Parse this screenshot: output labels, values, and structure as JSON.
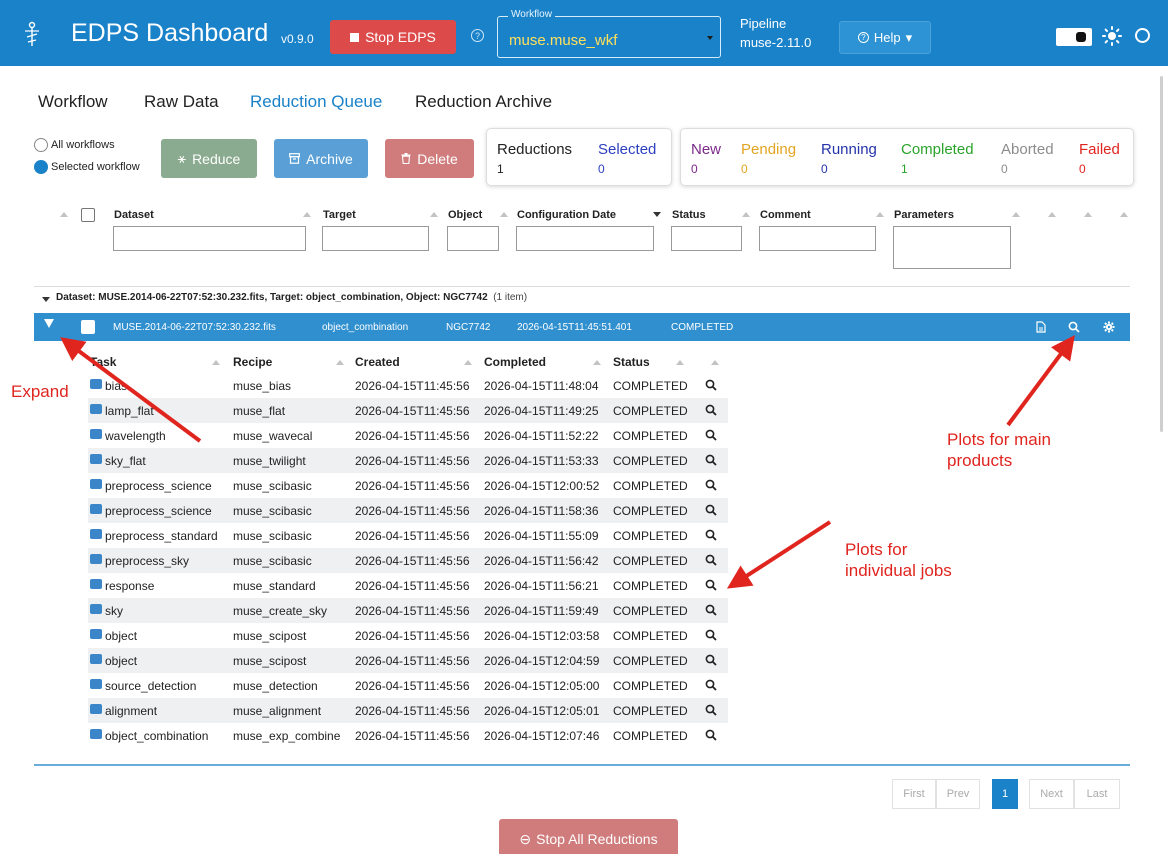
{
  "header": {
    "title": "EDPS Dashboard",
    "version": "v0.9.0",
    "stop_label": "Stop EDPS",
    "workflow_legend": "Workflow",
    "workflow_value": "muse.muse_wkf",
    "pipeline_label": "Pipeline",
    "pipeline_value": "muse-2.11.0",
    "help_label": "Help",
    "help_caret": "▾",
    "colors": {
      "bar": "#1a82c9",
      "workflow_value": "#ffe05a",
      "stop": "#dc4a4a"
    }
  },
  "tabs": [
    "Workflow",
    "Raw Data",
    "Reduction Queue",
    "Reduction Archive"
  ],
  "controls": {
    "radio_all": "All workflows",
    "radio_selected": "Selected workflow",
    "reduce": "Reduce",
    "archive": "Archive",
    "delete": "Delete"
  },
  "stats_left": [
    {
      "label": "Reductions",
      "value": "1",
      "color": "#222222"
    },
    {
      "label": "Selected",
      "value": "0",
      "color": "#2d3fbf"
    }
  ],
  "stats_right": [
    {
      "label": "New",
      "value": "0",
      "color": "#7b2a8a"
    },
    {
      "label": "Pending",
      "value": "0",
      "color": "#e3a521"
    },
    {
      "label": "Running",
      "value": "0",
      "color": "#2534a8"
    },
    {
      "label": "Completed",
      "value": "1",
      "color": "#2aa32a"
    },
    {
      "label": "Aborted",
      "value": "0",
      "color": "#8c8c8c"
    },
    {
      "label": "Failed",
      "value": "0",
      "color": "#e0251f"
    }
  ],
  "table_headers": {
    "dataset": "Dataset",
    "target": "Target",
    "object": "Object",
    "config_date": "Configuration Date",
    "status": "Status",
    "comment": "Comment",
    "parameters": "Parameters"
  },
  "group": {
    "label": "Dataset: MUSE.2014-06-22T07:52:30.232.fits, Target: object_combination, Object: NGC7742",
    "count": "(1 item)"
  },
  "selected_row": {
    "dataset": "MUSE.2014-06-22T07:52:30.232.fits",
    "target": "object_combination",
    "object": "NGC7742",
    "date": "2026-04-15T11:45:51.401",
    "status": "COMPLETED"
  },
  "jobs_headers": {
    "task": "Task",
    "recipe": "Recipe",
    "created": "Created",
    "completed": "Completed",
    "status": "Status"
  },
  "jobs": [
    {
      "task": "bias",
      "recipe": "muse_bias",
      "created": "2026-04-15T11:45:56",
      "completed": "2026-04-15T11:48:04",
      "status": "COMPLETED"
    },
    {
      "task": "lamp_flat",
      "recipe": "muse_flat",
      "created": "2026-04-15T11:45:56",
      "completed": "2026-04-15T11:49:25",
      "status": "COMPLETED"
    },
    {
      "task": "wavelength",
      "recipe": "muse_wavecal",
      "created": "2026-04-15T11:45:56",
      "completed": "2026-04-15T11:52:22",
      "status": "COMPLETED"
    },
    {
      "task": "sky_flat",
      "recipe": "muse_twilight",
      "created": "2026-04-15T11:45:56",
      "completed": "2026-04-15T11:53:33",
      "status": "COMPLETED"
    },
    {
      "task": "preprocess_science",
      "recipe": "muse_scibasic",
      "created": "2026-04-15T11:45:56",
      "completed": "2026-04-15T12:00:52",
      "status": "COMPLETED"
    },
    {
      "task": "preprocess_science",
      "recipe": "muse_scibasic",
      "created": "2026-04-15T11:45:56",
      "completed": "2026-04-15T11:58:36",
      "status": "COMPLETED"
    },
    {
      "task": "preprocess_standard",
      "recipe": "muse_scibasic",
      "created": "2026-04-15T11:45:56",
      "completed": "2026-04-15T11:55:09",
      "status": "COMPLETED"
    },
    {
      "task": "preprocess_sky",
      "recipe": "muse_scibasic",
      "created": "2026-04-15T11:45:56",
      "completed": "2026-04-15T11:56:42",
      "status": "COMPLETED"
    },
    {
      "task": "response",
      "recipe": "muse_standard",
      "created": "2026-04-15T11:45:56",
      "completed": "2026-04-15T11:56:21",
      "status": "COMPLETED"
    },
    {
      "task": "sky",
      "recipe": "muse_create_sky",
      "created": "2026-04-15T11:45:56",
      "completed": "2026-04-15T11:59:49",
      "status": "COMPLETED"
    },
    {
      "task": "object",
      "recipe": "muse_scipost",
      "created": "2026-04-15T11:45:56",
      "completed": "2026-04-15T12:03:58",
      "status": "COMPLETED"
    },
    {
      "task": "object",
      "recipe": "muse_scipost",
      "created": "2026-04-15T11:45:56",
      "completed": "2026-04-15T12:04:59",
      "status": "COMPLETED"
    },
    {
      "task": "source_detection",
      "recipe": "muse_detection",
      "created": "2026-04-15T11:45:56",
      "completed": "2026-04-15T12:05:00",
      "status": "COMPLETED"
    },
    {
      "task": "alignment",
      "recipe": "muse_alignment",
      "created": "2026-04-15T11:45:56",
      "completed": "2026-04-15T12:05:01",
      "status": "COMPLETED"
    },
    {
      "task": "object_combination",
      "recipe": "muse_exp_combine",
      "created": "2026-04-15T11:45:56",
      "completed": "2026-04-15T12:07:46",
      "status": "COMPLETED"
    }
  ],
  "annotations": {
    "expand": "Expand",
    "plots_main_1": "Plots for main",
    "plots_main_2": "products",
    "plots_jobs_1": "Plots for",
    "plots_jobs_2": "individual jobs",
    "color": "#e0251f"
  },
  "pagination": [
    "First",
    "Prev",
    "1",
    "Next",
    "Last"
  ],
  "stop_all": "Stop All Reductions"
}
